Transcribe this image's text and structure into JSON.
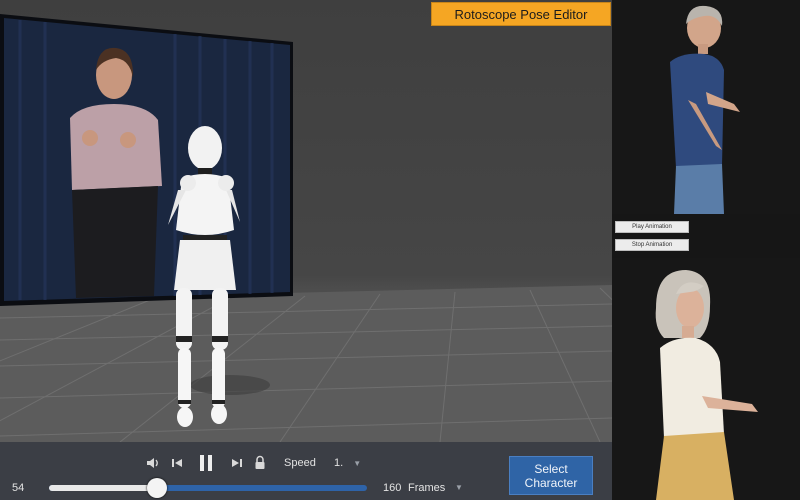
{
  "app": {
    "title": "Rotoscope Pose Editor"
  },
  "playback": {
    "speed_label": "Speed",
    "speed_value": "1.",
    "current_frame": "54",
    "total_frames": "160",
    "frames_label": "Frames",
    "progress_fraction": 0.34,
    "icons": [
      "volume-icon",
      "skip-back-icon",
      "pause-icon",
      "skip-forward-icon",
      "lock-icon",
      "chevron-down-icon"
    ]
  },
  "actions": {
    "select_character": "Select Character",
    "play_animation": "Play Animation",
    "stop_animation": "Stop Animation"
  },
  "colors": {
    "title_accent": "#f5a623",
    "select_button": "#2f64a6",
    "timeline_track": "#2e63a8",
    "playback_bar": "#3b3e45"
  }
}
